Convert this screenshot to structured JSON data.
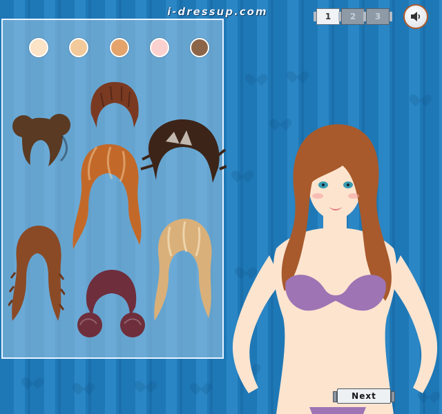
{
  "site": {
    "logo_text": "i-dressup.com"
  },
  "pager": {
    "pages": [
      "1",
      "2",
      "3"
    ],
    "active_page": "1"
  },
  "sound": {
    "icon": "speaker-icon"
  },
  "hair_panel": {
    "skin_tones": [
      "#fbe3c7",
      "#f2c99a",
      "#e3a36a",
      "#fbd1cf",
      "#8c6548"
    ],
    "hairstyles": [
      {
        "name": "short-tousled-dark-auburn",
        "color": "#7a3a22"
      },
      {
        "name": "twin-pigtail-buns-brown",
        "color": "#5a3a22"
      },
      {
        "name": "spiky-highlighted-brunette",
        "color": "#3c2418"
      },
      {
        "name": "long-wavy-copper",
        "color": "#c2692a"
      },
      {
        "name": "long-crimped-chestnut",
        "color": "#8a4a26"
      },
      {
        "name": "shoulder-length-blonde",
        "color": "#d9b07a"
      },
      {
        "name": "bob-with-side-buns-plum",
        "color": "#6e2e3c"
      }
    ]
  },
  "model": {
    "hair_color": "#a85a2c",
    "top_color": "#9e74b4",
    "skin_color": "#fde4cf"
  },
  "next_button": {
    "label": "Next"
  }
}
